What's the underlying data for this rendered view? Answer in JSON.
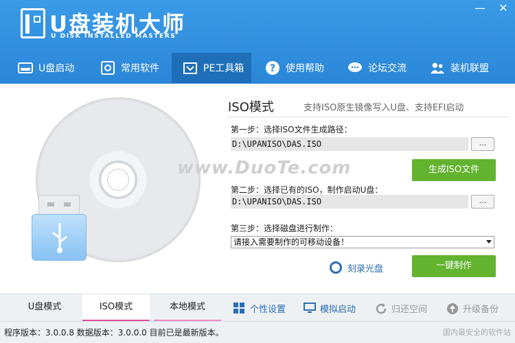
{
  "app": {
    "title": "U盘装机大师",
    "subtitle": "U DISK INSTALLED MASTERS"
  },
  "window": {
    "minimize": "—",
    "close": "✕"
  },
  "nav": [
    {
      "label": "U盘启动",
      "icon": "usb-drive-icon"
    },
    {
      "label": "常用软件",
      "icon": "gear-icon"
    },
    {
      "label": "PE工具箱",
      "icon": "toolbox-icon"
    },
    {
      "label": "使用帮助",
      "icon": "help-icon"
    },
    {
      "label": "论坛交流",
      "icon": "chat-icon"
    },
    {
      "label": "装机联盟",
      "icon": "users-icon"
    }
  ],
  "iso": {
    "title": "ISO模式",
    "description": "支持ISO原生镜像写入U盘、支持EFI启动",
    "step1_label": "第一步：选择ISO文件生成路径：",
    "step1_path": "D:\\UPANISO\\DAS.ISO",
    "browse": "...",
    "generate": "生成ISO文件",
    "step2_label": "第二步：选择已有的ISO，制作启动U盘：",
    "step2_path": "D:\\UPANISO\\DAS.ISO",
    "step3_label": "第三步：选择磁盘进行制作：",
    "device_select": "请接入需要制作的可移动设备！",
    "burn": "刻录光盘",
    "one_click": "一键制作"
  },
  "watermark": "www.DuoTe.com",
  "tabs": {
    "usb_mode": "U盘模式",
    "iso_mode": "ISO模式",
    "local_mode": "本地模式",
    "personalize": "个性设置",
    "simulate": "模拟启动",
    "restore": "归还空间",
    "upgrade": "升级备份"
  },
  "status": {
    "text": "程序版本：3.0.0.8  数据版本：3.0.0.0 目前已是最新版本。",
    "corner": "国内最安全的软件站"
  },
  "colors": {
    "header": "#2b86d8",
    "nav_active": "#1e6fb8",
    "green": "#62b32e",
    "link": "#2b6db3",
    "tab_accent": "#e24a9c"
  }
}
